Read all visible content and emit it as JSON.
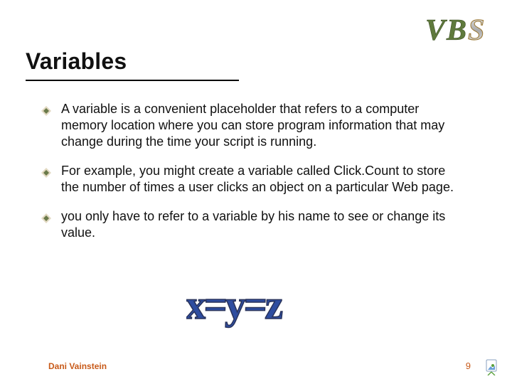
{
  "slide": {
    "title": "Variables",
    "bullets": [
      "A variable is a convenient placeholder that refers to a computer memory location where you can store program information that may change during the time your script is running.",
      "For example, you might create a variable called Click.Count to store the number of times a user clicks an object on a particular Web page.",
      "you only have to refer to a variable by his name to see or change its value."
    ],
    "equation_text": "x=y=z",
    "logo_text": "VBS",
    "footer": {
      "author": "Dani Vainstein",
      "page": "9"
    },
    "colors": {
      "author": "#C85A19",
      "equation_fill": "#2E4DA0",
      "equation_stroke": "#29335B",
      "logo_v": "#5F7A3C",
      "logo_b": "#5F7A3C",
      "logo_s": "#9A762F",
      "bullet_light": "#E2D9C2",
      "bullet_dark": "#6A7A4A"
    }
  }
}
